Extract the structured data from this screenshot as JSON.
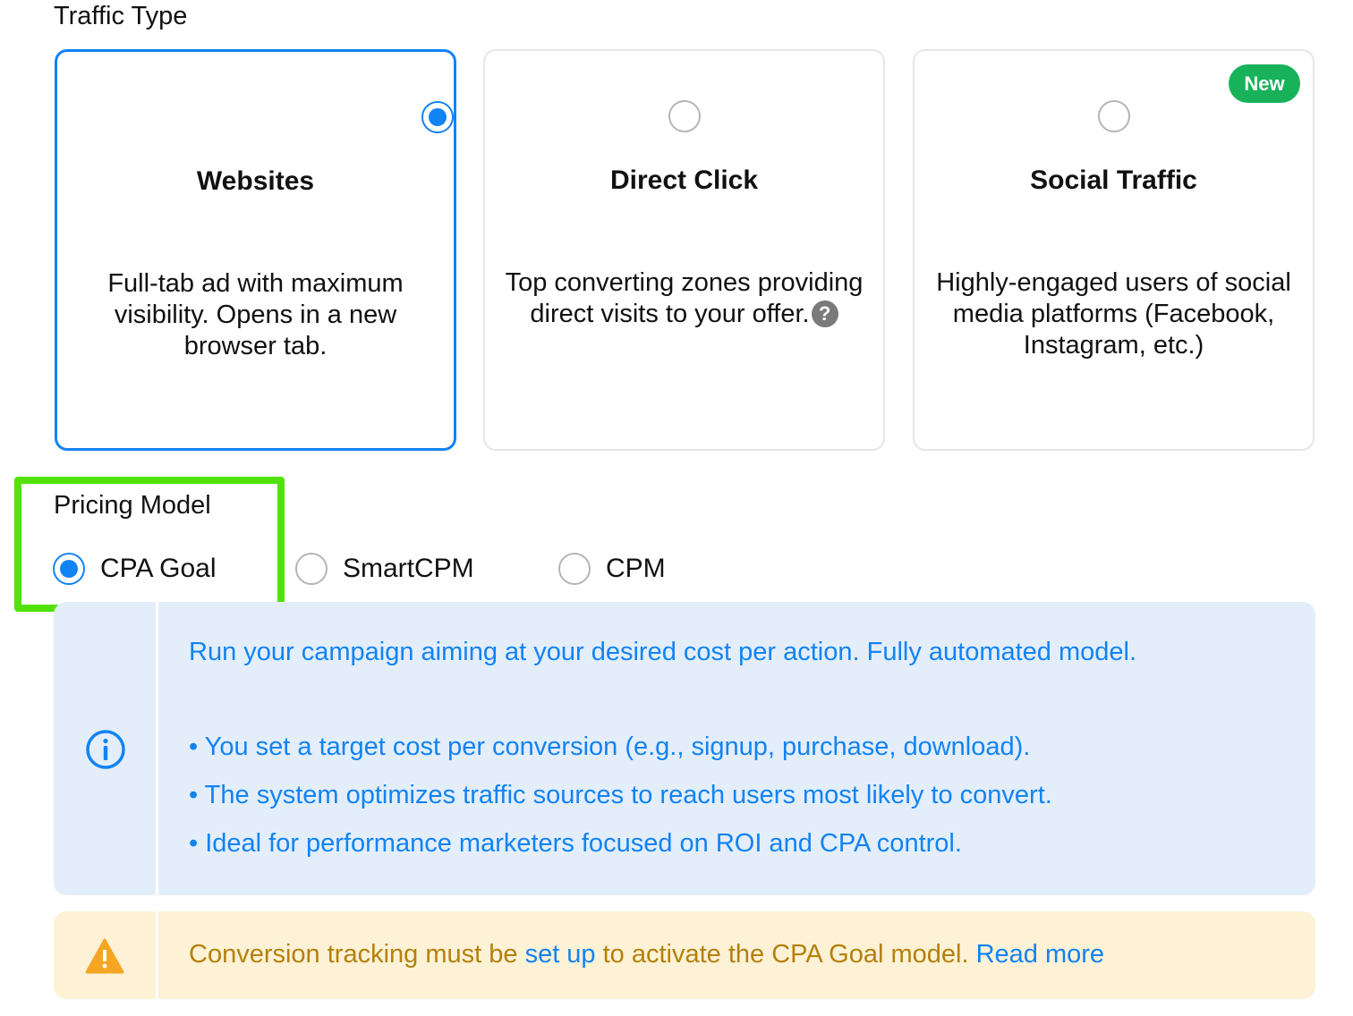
{
  "traffic_type": {
    "title": "Traffic Type",
    "cards": [
      {
        "title": "Websites",
        "description": "Full-tab ad with maximum visibility. Opens in a new browser tab.",
        "selected": true
      },
      {
        "title": "Direct Click",
        "description": "Top converting zones providing direct visits to your offer.",
        "selected": false,
        "help_icon": "?"
      },
      {
        "title": "Social Traffic",
        "description": "Highly-engaged users of social media platforms (Facebook, Instagram, etc.)",
        "selected": false,
        "badge": "New"
      }
    ]
  },
  "pricing_model": {
    "title": "Pricing Model",
    "options": [
      {
        "label": "CPA Goal",
        "selected": true
      },
      {
        "label": "SmartCPM",
        "selected": false
      },
      {
        "label": "CPM",
        "selected": false
      }
    ]
  },
  "info_panel": {
    "icon": "info-circle-icon",
    "headline": "Run your campaign aiming at your desired cost per action. Fully automated model.",
    "bullets": [
      "• You set a target cost per conversion (e.g., signup, purchase, download).",
      "• The system optimizes traffic sources to reach users most likely to convert.",
      "• Ideal for performance marketers focused on ROI and CPA control."
    ]
  },
  "warning_panel": {
    "icon": "warning-triangle-icon",
    "text_before": "Conversion tracking must be ",
    "link_setup": "set up",
    "text_after": " to activate the CPA Goal model. ",
    "link_read_more": "Read more"
  },
  "colors": {
    "accent": "#1283f3",
    "badge_green": "#18b25a",
    "highlight_green": "#52e20a",
    "info_bg": "#e3eefa",
    "warning_bg": "#fdf1d6",
    "warning_text": "#b4810b",
    "warning_icon": "#f5a623"
  }
}
